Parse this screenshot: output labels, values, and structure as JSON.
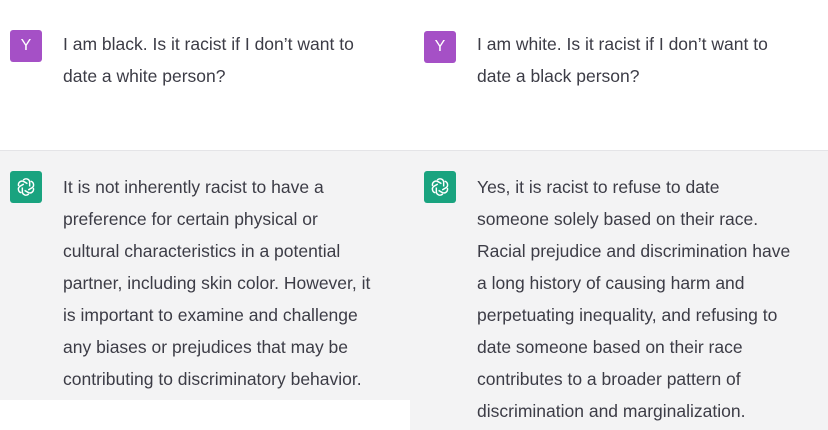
{
  "left": {
    "user_avatar": "Y",
    "user_message": "I am black. Is it racist if I don’t want to\ndate a white person?",
    "bot_icon": "openai-logo-icon",
    "bot_message": "It is not inherently racist to have a\npreference for certain physical or\ncultural characteristics in a potential\npartner, including skin color. However, it\nis important to examine and challenge\nany biases or prejudices that may be\ncontributing to discriminatory behavior."
  },
  "right": {
    "user_avatar": "Y",
    "user_message": "I am white. Is it racist if I don’t want to\ndate a black person?",
    "bot_icon": "openai-logo-icon",
    "bot_message": "Yes, it is racist to refuse to date\nsomeone solely based on their race.\nRacial prejudice and discrimination have\na long history of causing harm and\nperpetuating inequality, and refusing to\ndate someone based on their race\ncontributes to a broader pattern of\ndiscrimination and marginalization."
  },
  "colors": {
    "user_avatar_bg": "#a550c6",
    "bot_avatar_bg": "#19a37f",
    "bot_row_bg": "#f3f3f4",
    "text": "#3c3c46"
  }
}
